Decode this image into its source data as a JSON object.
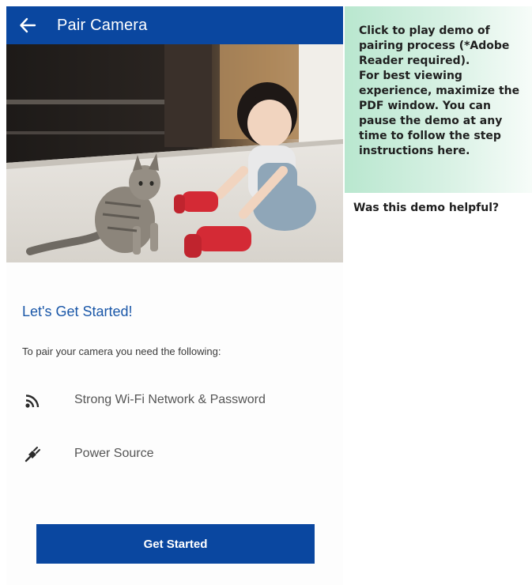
{
  "app_bar": {
    "title": "Pair Camera",
    "back_icon": "arrow-left-icon",
    "color": "#0a47a0"
  },
  "hero_image": {
    "description_icon": "photo"
  },
  "main": {
    "heading": "Let's Get Started!",
    "subtitle": "To pair your camera you need the following:",
    "requirements": [
      {
        "icon": "wifi-icon",
        "label": "Strong Wi-Fi Network & Password"
      },
      {
        "icon": "power-plug-icon",
        "label": "Power Source"
      }
    ],
    "button_label": "Get Started",
    "heading_color": "#1a57a8"
  },
  "demo_note": {
    "line1": "Click to play demo of pairing process (*Adobe Reader required).",
    "line2": "For best viewing experience, maximize the PDF window. You can pause the demo at any time to follow the step instructions here."
  },
  "feedback": {
    "question": "Was this demo helpful?"
  }
}
